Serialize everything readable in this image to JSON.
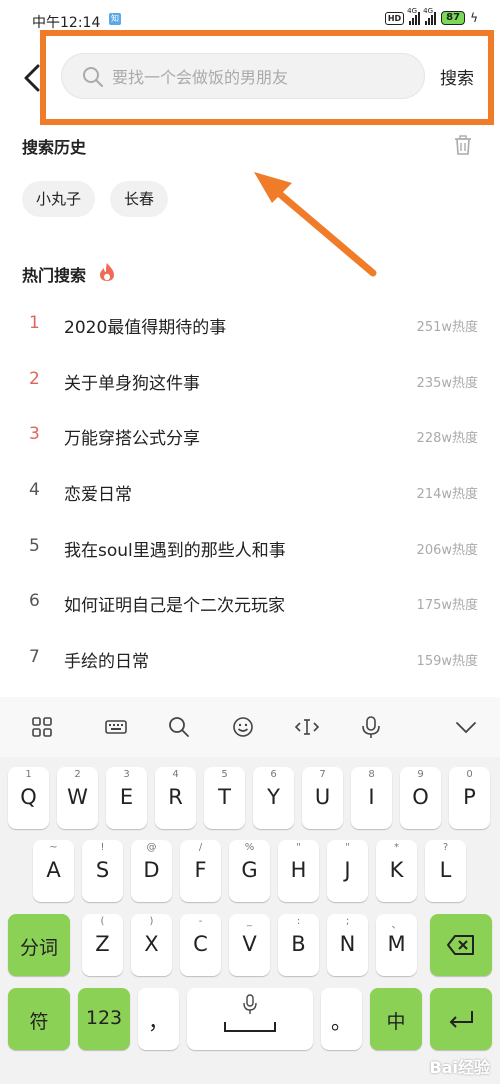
{
  "status": {
    "time": "中午12:14",
    "app_badge": "知",
    "hd": "HD",
    "net1": "4G",
    "net2": "4G",
    "battery": "87"
  },
  "header": {
    "search_placeholder": "要找一个会做饭的男朋友",
    "search_button": "搜索"
  },
  "history": {
    "title": "搜索历史",
    "chips": [
      "小丸子",
      "长春"
    ]
  },
  "hot": {
    "title": "热门搜索",
    "items": [
      {
        "rank": "1",
        "text": "2020最值得期待的事",
        "heat": "251w热度"
      },
      {
        "rank": "2",
        "text": "关于单身狗这件事",
        "heat": "235w热度"
      },
      {
        "rank": "3",
        "text": "万能穿搭公式分享",
        "heat": "228w热度"
      },
      {
        "rank": "4",
        "text": "恋爱日常",
        "heat": "214w热度"
      },
      {
        "rank": "5",
        "text": "我在soul里遇到的那些人和事",
        "heat": "206w热度"
      },
      {
        "rank": "6",
        "text": "如何证明自己是个二次元玩家",
        "heat": "175w热度"
      },
      {
        "rank": "7",
        "text": "手绘的日常",
        "heat": "159w热度"
      }
    ]
  },
  "keyboard": {
    "row1": [
      {
        "key": "Q",
        "sub": "1"
      },
      {
        "key": "W",
        "sub": "2"
      },
      {
        "key": "E",
        "sub": "3"
      },
      {
        "key": "R",
        "sub": "4"
      },
      {
        "key": "T",
        "sub": "5"
      },
      {
        "key": "Y",
        "sub": "6"
      },
      {
        "key": "U",
        "sub": "7"
      },
      {
        "key": "I",
        "sub": "8"
      },
      {
        "key": "O",
        "sub": "9"
      },
      {
        "key": "P",
        "sub": "0"
      }
    ],
    "row2": [
      {
        "key": "A",
        "sub": "~"
      },
      {
        "key": "S",
        "sub": "!"
      },
      {
        "key": "D",
        "sub": "@"
      },
      {
        "key": "F",
        "sub": "/"
      },
      {
        "key": "G",
        "sub": "%"
      },
      {
        "key": "H",
        "sub": "\""
      },
      {
        "key": "J",
        "sub": "\""
      },
      {
        "key": "K",
        "sub": "*"
      },
      {
        "key": "L",
        "sub": "?"
      }
    ],
    "row3": [
      {
        "key": "Z",
        "sub": "("
      },
      {
        "key": "X",
        "sub": ")"
      },
      {
        "key": "C",
        "sub": "-"
      },
      {
        "key": "V",
        "sub": "_"
      },
      {
        "key": "B",
        "sub": ":"
      },
      {
        "key": "N",
        "sub": ";"
      },
      {
        "key": "M",
        "sub": "、"
      }
    ],
    "fenci": "分词",
    "fu": "符",
    "num": "123",
    "comma": "，",
    "period": "。",
    "zhong": "中"
  },
  "watermark": "Bai经验",
  "colors": {
    "accent_green": "#8bd155",
    "highlight_orange": "#f07c2a",
    "rank_red": "#e0665a"
  }
}
